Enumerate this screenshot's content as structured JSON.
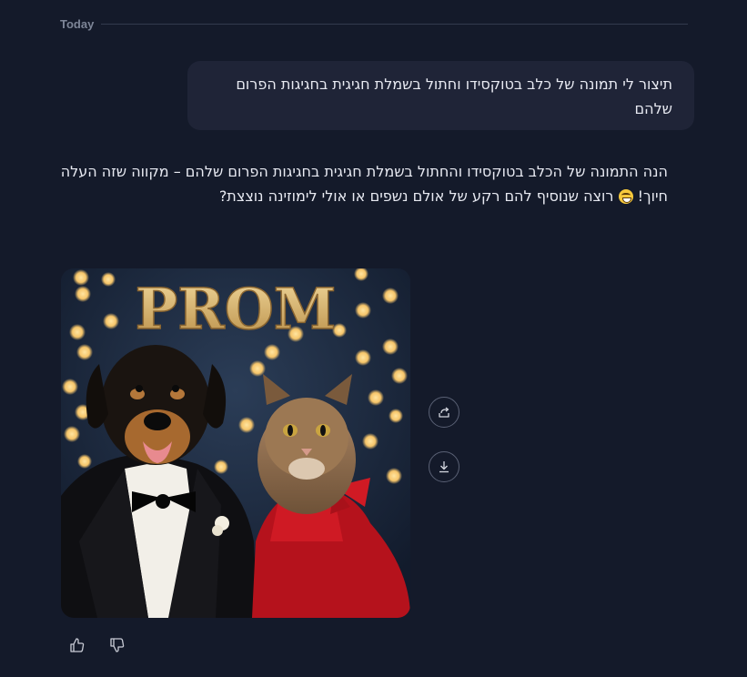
{
  "conversation": {
    "day_label": "Today"
  },
  "user_message": {
    "text": "תיצור לי תמונה של כלב בטוקסידו וחתול בשמלת חגיגית בחגיגות הפרום שלהם"
  },
  "assistant_message": {
    "text_before_emoji": "הנה התמונה של הכלב בטוקסידו והחתול בשמלת חגיגית בחגיגות הפרום שלהם – מקווה שזה העלה חיוך!",
    "emoji": "grinning-face",
    "text_after_emoji": "רוצה שנוסיף להם רקע של אולם נשפים או אולי לימוזינה נוצצת?"
  },
  "generated_image": {
    "sign_text": "PROM",
    "subject": "dog-in-tuxedo-and-cat-in-red-dress",
    "colors": {
      "background": "#1d2a3f",
      "bokeh": "#f6c56a",
      "dress": "#c3141d",
      "tuxedo": "#111111"
    }
  },
  "image_actions": {
    "share_icon": "share-icon",
    "download_icon": "download-icon"
  },
  "feedback": {
    "like_icon": "thumbs-up-icon",
    "dislike_icon": "thumbs-down-icon"
  }
}
